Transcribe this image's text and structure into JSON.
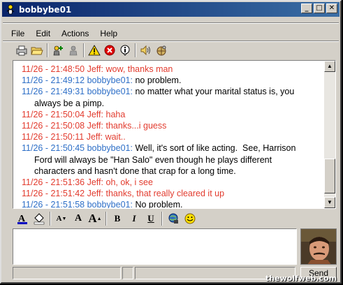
{
  "window": {
    "title": "bobbybe01"
  },
  "title_buttons": {
    "minimize": "_",
    "maximize": "□",
    "close": "✕"
  },
  "menu": [
    "File",
    "Edit",
    "Actions",
    "Help"
  ],
  "toolbar": {
    "icons": [
      "print-icon",
      "open-folder-icon",
      "add-buddy-icon",
      "block-icon",
      "warning-icon",
      "stop-icon",
      "info-icon",
      "sound-icon",
      "game-icon"
    ]
  },
  "chat": {
    "lines": [
      {
        "ts": "11/26 - 21:48:50",
        "user": "Jeff:",
        "text": "wow, thanks man",
        "color": "red"
      },
      {
        "ts": "11/26 - 21:49:12",
        "user": "bobbybe01:",
        "text": "no problem.",
        "color": "blue"
      },
      {
        "ts": "11/26 - 21:49:31",
        "user": "bobbybe01:",
        "text": "no matter what your marital status is, you",
        "color": "blue"
      },
      {
        "ts": "",
        "user": "",
        "text": "always be a pimp.",
        "color": "blue",
        "cont": true
      },
      {
        "ts": "11/26 - 21:50:04",
        "user": "Jeff:",
        "text": "haha",
        "color": "red"
      },
      {
        "ts": "11/26 - 21:50:08",
        "user": "Jeff:",
        "text": "thanks...i guess",
        "color": "red"
      },
      {
        "ts": "11/26 - 21:50:11",
        "user": "Jeff:",
        "text": "wait..",
        "color": "red"
      },
      {
        "ts": "11/26 - 21:50:45",
        "user": "bobbybe01:",
        "text": "Well, it's sort of like acting.  See, Harrison",
        "color": "blue"
      },
      {
        "ts": "",
        "user": "",
        "text": "Ford will always be \"Han Salo\" even though he plays different",
        "color": "blue",
        "cont": true
      },
      {
        "ts": "",
        "user": "",
        "text": "characters and hasn't done that crap for a long time.",
        "color": "blue",
        "cont": true
      },
      {
        "ts": "11/26 - 21:51:36",
        "user": "Jeff:",
        "text": "oh, ok, i see",
        "color": "red"
      },
      {
        "ts": "11/26 - 21:51:42",
        "user": "Jeff:",
        "text": "thanks, that really cleared it up",
        "color": "red"
      },
      {
        "ts": "11/26 - 21:51:58",
        "user": "bobbybe01:",
        "text": "No problem.",
        "color": "blue"
      }
    ]
  },
  "format": {
    "bold": "B",
    "italic": "I",
    "underline": "U",
    "small_a": "A",
    "med_a": "A",
    "large_a": "A"
  },
  "input": {
    "value": ""
  },
  "send": {
    "label": "Send"
  },
  "watermark": "thewolfweb.com",
  "colors": {
    "red": "#e23b2e",
    "blue": "#2e6fc7",
    "titlebar": "#0a246a"
  }
}
